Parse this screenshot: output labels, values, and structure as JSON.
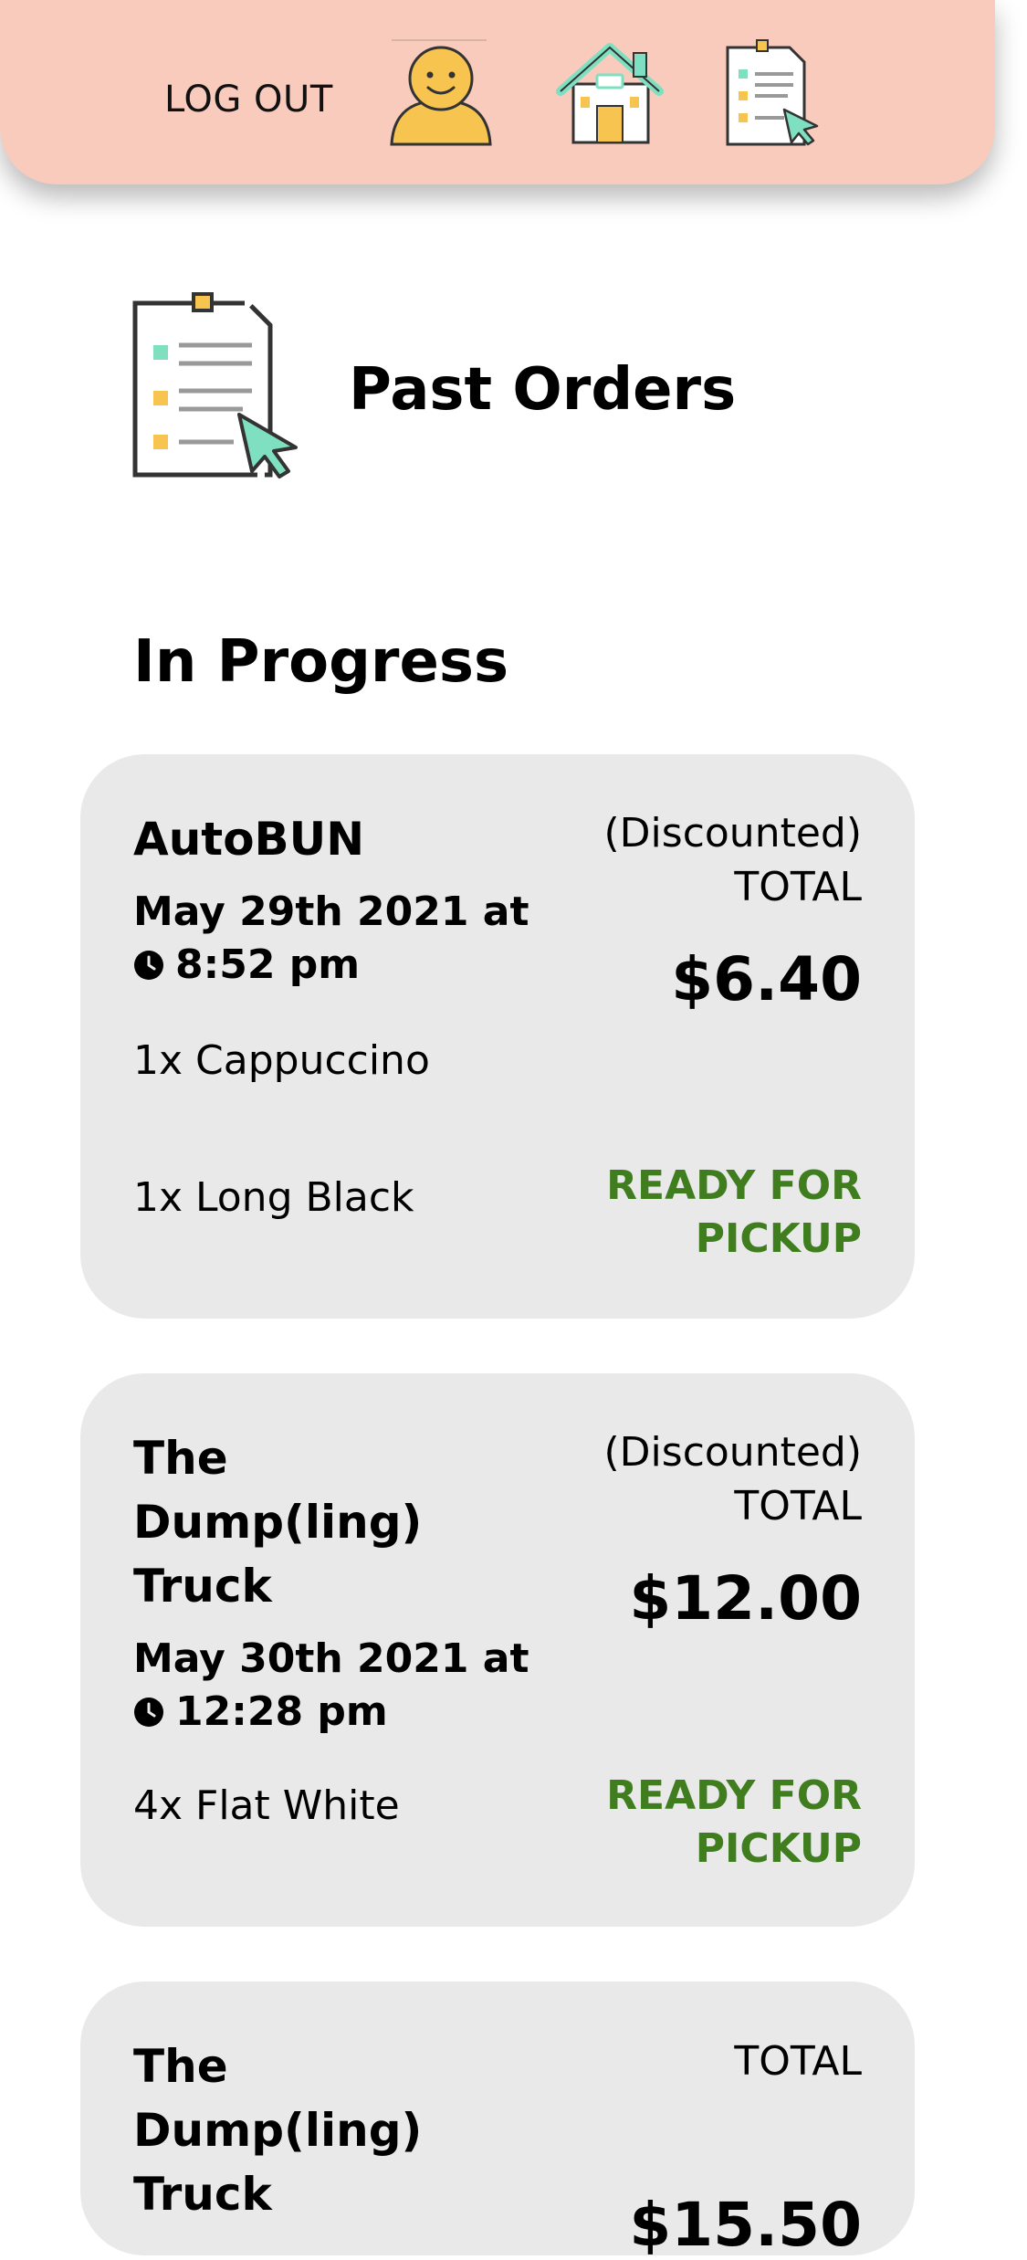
{
  "header": {
    "logout_label": "LOG OUT",
    "icons": [
      "profile-icon",
      "home-icon",
      "orders-icon"
    ]
  },
  "page": {
    "title": "Past Orders",
    "section_title": "In Progress"
  },
  "colors": {
    "header_bg": "#f8cbbd",
    "card_bg": "#e9e9e9",
    "status_green": "#3f7d1f",
    "icon_yellow": "#f7c44f",
    "icon_teal": "#7ee0c0"
  },
  "orders": [
    {
      "vendor": "AutoBUN",
      "date": "May 29th 2021 at",
      "time": "8:52 pm",
      "items": [
        "1x Cappuccino",
        "1x Long Black"
      ],
      "discount_label": "(Discounted)",
      "total_label": "TOTAL",
      "total": "$6.40",
      "status": "READY FOR PICKUP"
    },
    {
      "vendor": "The Dump(ling) Truck",
      "date": "May 30th 2021 at",
      "time": "12:28 pm",
      "items": [
        "4x Flat White"
      ],
      "discount_label": "(Discounted)",
      "total_label": "TOTAL",
      "total": "$12.00",
      "status": "READY FOR PICKUP"
    },
    {
      "vendor": "The Dump(ling) Truck",
      "total_label": "TOTAL",
      "total": "$15.50"
    }
  ]
}
